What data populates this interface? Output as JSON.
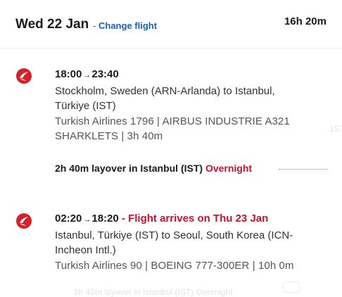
{
  "header": {
    "date": "Wed 22 Jan",
    "separator": "-",
    "change_flight": "Change flight",
    "total_duration": "16h 20m"
  },
  "segments": [
    {
      "airline_icon": "turkish-airlines-logo-icon",
      "depart_time": "18:00",
      "arrow": "→",
      "arrive_time": "23:40",
      "arrival_note": "",
      "route_line1": "Stockholm, Sweden (ARN-Arlanda) to Istanbul,",
      "route_line2": "Türkiye (IST)",
      "meta_line1": "Turkish Airlines 1796  |  AIRBUS INDUSTRIE A321",
      "meta_line2": "SHARKLETS  |  3h 40m"
    },
    {
      "airline_icon": "turkish-airlines-logo-icon",
      "depart_time": "02:20",
      "arrow": "→",
      "arrive_time": "18:20",
      "arrival_note": " - Flight arrives on Thu 23 Jan",
      "route_line1": "Istanbul, Türkiye (IST) to Seoul, South Korea (ICN-",
      "route_line2": "Incheon Intl.)",
      "meta_line1": "Turkish Airlines 90  |  BOEING 777-300ER  |  10h 0m",
      "meta_line2": ""
    }
  ],
  "layover": {
    "text": "2h 40m layover in Istanbul (IST) ",
    "flag": "Overnight"
  },
  "ghost": {
    "right_text": "1ST",
    "bottom_text": "2h 40m layover in Istanbul (IST) Overnight"
  },
  "colors": {
    "accent_link": "#1a5fb4",
    "alert_red": "#c8102e",
    "brand_red": "#d8202a"
  }
}
